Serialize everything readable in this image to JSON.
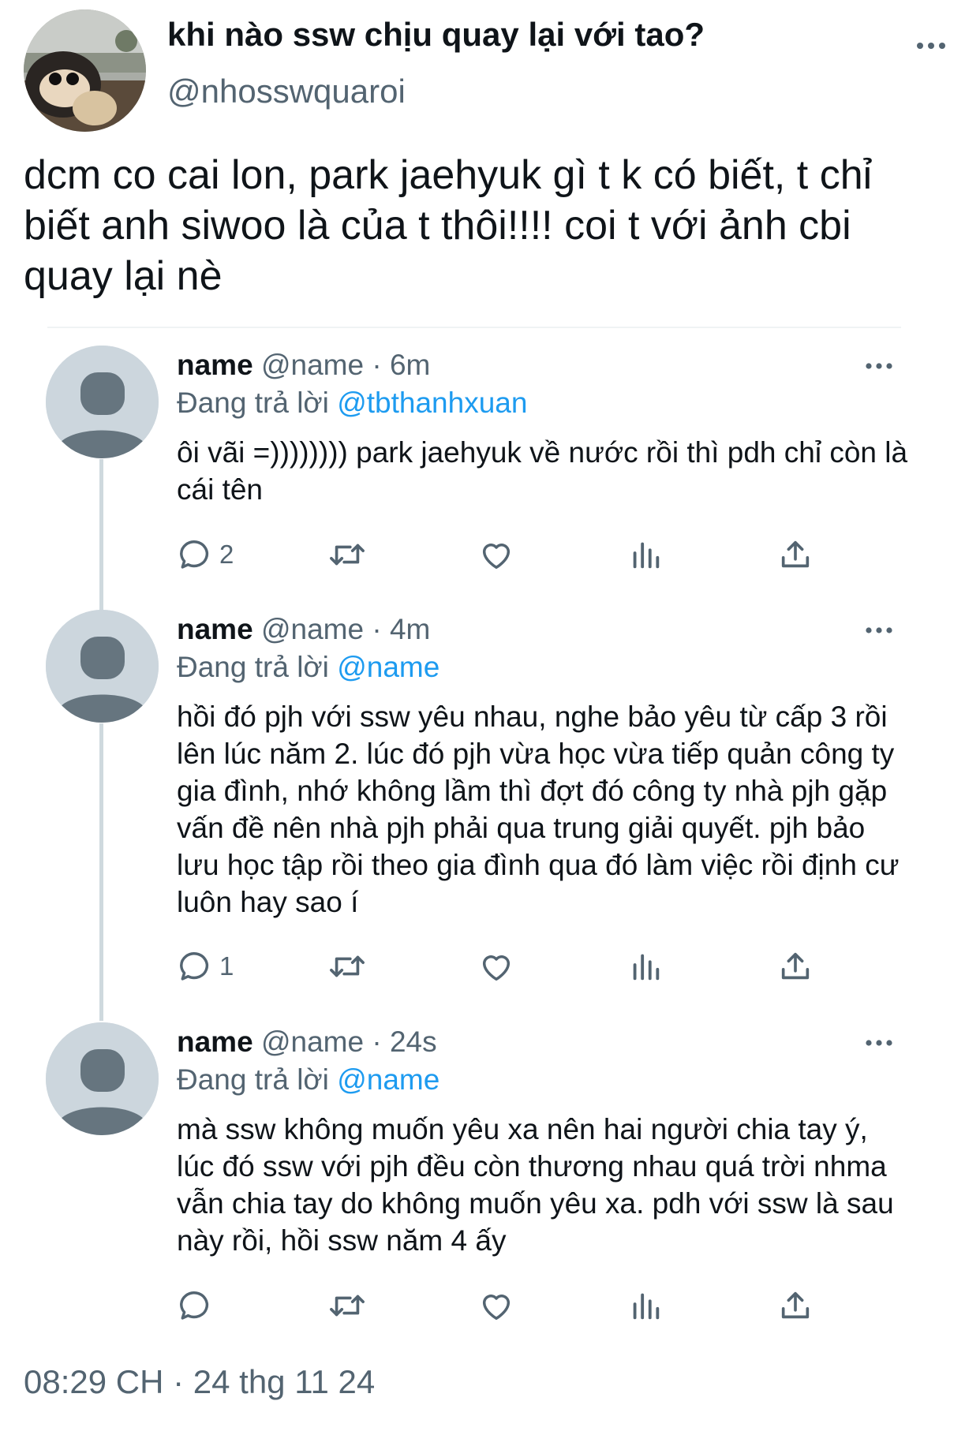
{
  "tweet": {
    "display_name": "khi nào ssw chịu quay lại với tao?",
    "handle": "@nhosswquaroi",
    "text": "dcm co cai lon, park jaehyuk gì t k có biết, t chỉ\nbiết anh siwoo là của t thôi!!!! coi t với ảnh cbi\nquay lại nè",
    "timestamp": "08:29 CH · 24 thg 11 24"
  },
  "replies": [
    {
      "name": "name",
      "handle": "@name",
      "time": "· 6m",
      "replying_label": "Đang trả lời",
      "replying_to": "@tbthanhxuan",
      "text": "ôi vãi =)))))))) park jaehyuk về nước rồi thì pdh chỉ còn là cái tên",
      "reply_count": "2"
    },
    {
      "name": "name",
      "handle": "@name",
      "time": "· 4m",
      "replying_label": "Đang trả lời",
      "replying_to": "@name",
      "text": "hồi đó pjh với ssw yêu nhau, nghe bảo yêu từ cấp 3 rồi lên lúc năm 2. lúc đó pjh vừa học vừa tiếp quản công ty gia đình, nhớ không lầm thì đợt đó công ty nhà pjh gặp vấn đề nên nhà pjh phải qua trung giải quyết. pjh bảo lưu học tập rồi theo gia đình qua đó làm việc rồi định cư luôn hay sao í",
      "reply_count": "1"
    },
    {
      "name": "name",
      "handle": "@name",
      "time": "· 24s",
      "replying_label": "Đang trả lời",
      "replying_to": "@name",
      "text": "mà ssw không muốn yêu xa nên hai người chia tay ý, lúc đó ssw với pjh đều còn thương nhau quá trời nhma vẫn chia tay do không muốn yêu xa. pdh với ssw là sau này rồi, hồi ssw năm 4 ấy",
      "reply_count": ""
    }
  ],
  "icons": {
    "reply": "speech-bubble-icon",
    "retweet": "retweet-icon",
    "like": "heart-icon",
    "views": "bar-chart-icon",
    "share": "share-icon",
    "more": "more-dots-icon"
  },
  "colors": {
    "text": "#0f1419",
    "secondary": "#536471",
    "mention": "#1d9bf0",
    "avatar_placeholder": "#ccd6dd",
    "avatar_silhouette": "#66757f"
  }
}
